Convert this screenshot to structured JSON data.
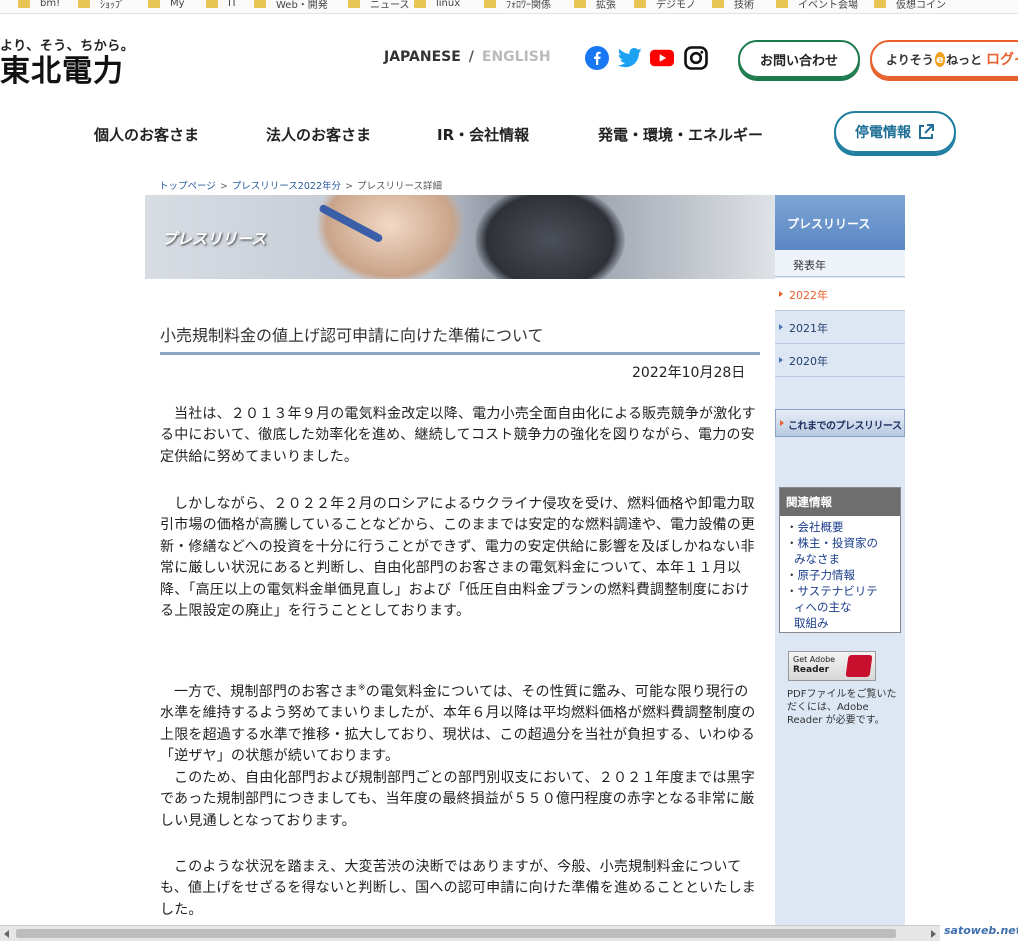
{
  "bookmarks": [
    {
      "label": "bm!"
    },
    {
      "label": "ｼｮｯﾌﾟ"
    },
    {
      "label": "My"
    },
    {
      "label": "IT"
    },
    {
      "label": "Web・開発"
    },
    {
      "label": "ニュース"
    },
    {
      "label": "linux"
    },
    {
      "label": "ﾌｫﾛﾜｰ関係"
    },
    {
      "label": "拡張"
    },
    {
      "label": "デジモノ"
    },
    {
      "label": "技術"
    },
    {
      "label": "イベント会場"
    },
    {
      "label": "仮想コイン"
    }
  ],
  "header": {
    "tagline": "より、そう、ちから。",
    "brand": "東北電力",
    "lang_ja": "JAPANESE",
    "lang_sep": "/",
    "lang_en": "ENGLISH",
    "contact_label": "お問い合わせ",
    "login_prefix": "よりそう",
    "login_e": "e",
    "login_suffix": "ねっと",
    "login_action": "ログイ"
  },
  "sns": [
    {
      "icon": "facebook-icon",
      "color": "#1877f2"
    },
    {
      "icon": "twitter-icon",
      "color": "#1da1f2"
    },
    {
      "icon": "youtube-icon",
      "color": "#ff0000"
    },
    {
      "icon": "instagram-icon",
      "color": "#111111"
    }
  ],
  "nav": {
    "items": [
      "個人のお客さま",
      "法人のお客さま",
      "IR・会社情報",
      "発電・環境・エネルギー"
    ],
    "outage_label": "停電情報"
  },
  "breadcrumb": {
    "top": "トップページ",
    "sep": ">",
    "year": "プレスリリース2022年分",
    "current": "プレスリリース詳細"
  },
  "banner": {
    "title": "プレスリリース"
  },
  "sidebar": {
    "heading": "プレスリリース",
    "sub": "発表年",
    "years": [
      "2022年",
      "2021年",
      "2020年"
    ],
    "past_label": "これまでのプレスリリース",
    "related_heading": "関連情報",
    "related": [
      {
        "dot": "・",
        "text": "会社概要"
      },
      {
        "dot": "・",
        "text": "株主・投資家の"
      },
      {
        "dot": "",
        "text": "みなさま"
      },
      {
        "dot": "・",
        "text": "原子力情報"
      },
      {
        "dot": "・",
        "text": "サステナビリテ"
      },
      {
        "dot": "",
        "text": "ィへの主な"
      },
      {
        "dot": "",
        "text": "取組み"
      }
    ],
    "adobe_line1": "Get Adobe",
    "adobe_line2": "Reader",
    "pdf_note": "PDFファイルをご覧いただくには、Adobe Reader が必要です。"
  },
  "article": {
    "title": "小売規制料金の値上げ認可申請に向けた準備について",
    "date": "2022年10月28日",
    "p1": "当社は、２０１３年９月の電気料金改定以降、電力小売全面自由化による販売競争が激化する中において、徹底した効率化を進め、継続してコスト競争力の強化を図りながら、電力の安定供給に努めてまいりました。",
    "p2": "しかしながら、２０２２年２月のロシアによるウクライナ侵攻を受け、燃料価格や卸電力取引市場の価格が高騰していることなどから、このままでは安定的な燃料調達や、電力設備の更新・修繕などへの投資を十分に行うことができず、電力の安定供給に影響を及ぼしかねない非常に厳しい状況にあると判断し、自由化部門のお客さまの電気料金について、本年１１月以降、「高圧以上の電気料金単価見直し」および「低圧自由料金プランの燃料費調整制度における上限設定の廃止」を行うこととしております。",
    "p3a": "一方で、規制部門のお客さま",
    "p3mark": "※",
    "p3b": "の電気料金については、その性質に鑑み、可能な限り現行の水準を維持するよう努めてまいりましたが、本年６月以降は平均燃料価格が燃料費調整制度の上限を超過する水準で推移・拡大しており、現状は、この超過分を当社が負担する、いわゆる「逆ザヤ」の状態が続いております。",
    "p4": "このため、自由化部門および規制部門ごとの部門別収支において、２０２１年度までは黒字であった規制部門につきましても、当年度の最終損益が５５０億円程度の赤字となる非常に厳しい見通しとなっております。",
    "p5": "このような状況を踏まえ、大変苦渋の決断ではありますが、今般、小売規制料金についても、値上げをせざるを得ないと判断し、国への認可申請に向けた準備を進めることといたしました。"
  },
  "watermark": "satoweb.net"
}
